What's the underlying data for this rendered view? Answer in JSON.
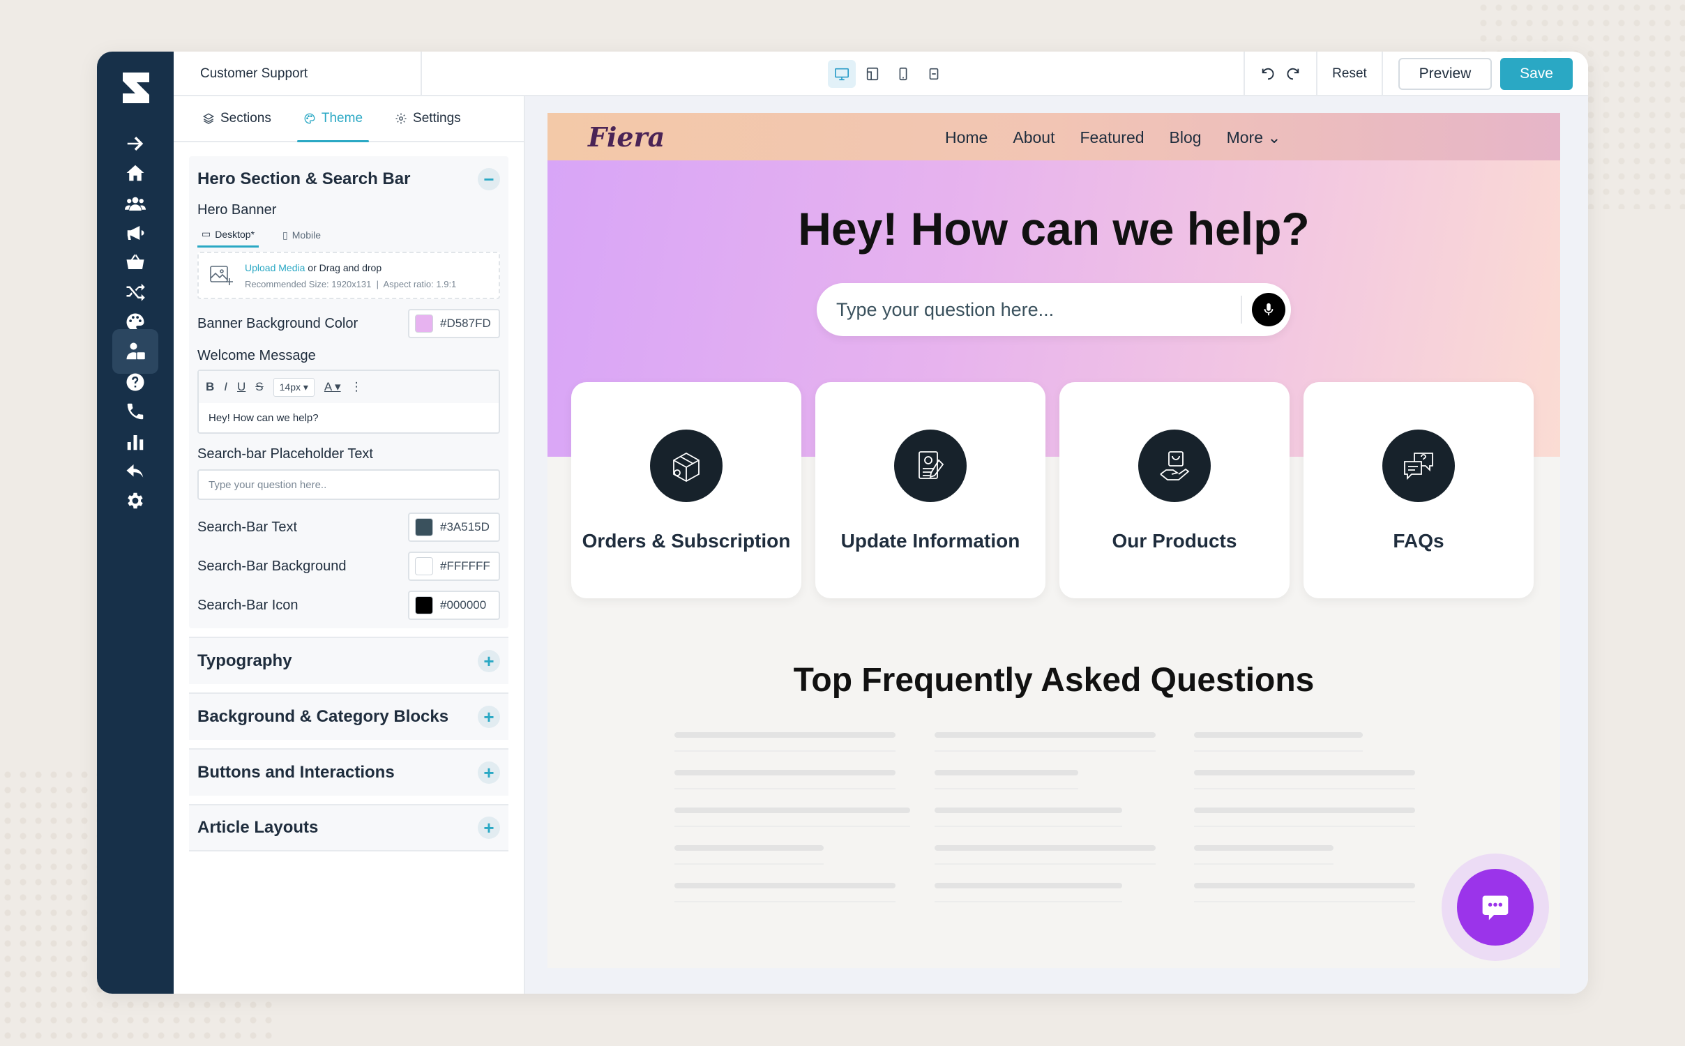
{
  "colors": {
    "accent": "#2aa8c4",
    "rail": "#173049",
    "chat": "#9b34ea"
  },
  "rail": {
    "items": [
      "arrow-right-icon",
      "home-icon",
      "users-icon",
      "megaphone-icon",
      "basket-icon",
      "shuffle-icon",
      "palette-icon",
      "agent-icon",
      "help-icon",
      "phone-icon",
      "bar-chart-icon",
      "reply-icon",
      "gear-icon"
    ],
    "active": "agent-icon"
  },
  "topbar": {
    "title": "Customer Support",
    "devices": [
      "desktop-icon",
      "tablet-landscape-icon",
      "mobile-icon",
      "resize-icon"
    ],
    "reset": "Reset",
    "preview": "Preview",
    "save": "Save"
  },
  "panel": {
    "tabs": [
      {
        "label": "Sections"
      },
      {
        "label": "Theme"
      },
      {
        "label": "Settings"
      }
    ],
    "active_tab": "Theme",
    "hero": {
      "title": "Hero Section & Search Bar",
      "banner_label": "Hero Banner",
      "subtabs": {
        "desktop": "Desktop*",
        "mobile": "Mobile"
      },
      "upload": {
        "link": "Upload Media",
        "or": "or",
        "drag": "Drag and drop",
        "size": "Recommended Size:  1920x131",
        "ratio": "Aspect ratio:  1.9:1"
      },
      "bg_color": {
        "label": "Banner Background Color",
        "value": "#D587FD"
      },
      "welcome": {
        "label": "Welcome Message",
        "font_size": "14px",
        "text": "Hey! How can we help?"
      },
      "placeholder": {
        "label": "Search-bar Placeholder Text",
        "value": "Type your question here.."
      },
      "sb_text": {
        "label": "Search-Bar Text",
        "value": "#3A515D"
      },
      "sb_bg": {
        "label": "Search-Bar Background",
        "value": "#FFFFFF"
      },
      "sb_icon": {
        "label": "Search-Bar Icon",
        "value": "#000000"
      }
    },
    "collapsed": [
      "Typography",
      "Background & Category Blocks",
      "Buttons and Interactions",
      "Article Layouts"
    ]
  },
  "preview": {
    "brand": "Fiera",
    "nav": [
      "Home",
      "About",
      "Featured",
      "Blog",
      "More"
    ],
    "hero_title": "Hey! How can we help?",
    "search_placeholder": "Type your question here...",
    "cards": [
      {
        "label": "Orders & Subscription",
        "icon": "box-location-icon"
      },
      {
        "label": "Update Information",
        "icon": "profile-document-icon"
      },
      {
        "label": "Our Products",
        "icon": "hand-bag-icon"
      },
      {
        "label": "FAQs",
        "icon": "question-chat-icon"
      }
    ],
    "faq_title": "Top Frequently Asked Questions"
  }
}
